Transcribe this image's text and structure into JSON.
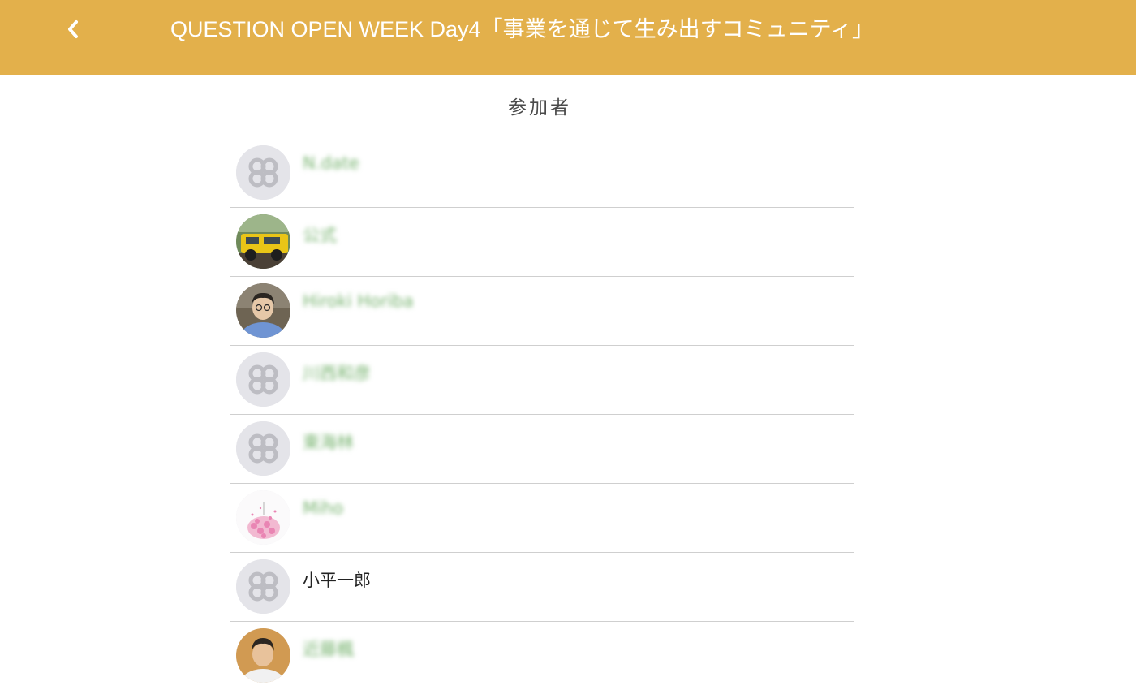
{
  "header": {
    "title": "QUESTION OPEN WEEK Day4「事業を通じて生み出すコミュニティ」",
    "back_icon": "chevron-left-icon",
    "background": "#e3b04b",
    "text_color": "#ffffff"
  },
  "participants": {
    "heading": "参加者",
    "items": [
      {
        "name": "N.date",
        "avatar": "default-avatar-icon",
        "blurred": true
      },
      {
        "name": "公式",
        "avatar": "photo-yellow-vehicle",
        "blurred": true
      },
      {
        "name": "Hiroki Horiba",
        "avatar": "photo-person-glasses",
        "blurred": true
      },
      {
        "name": "川西和彦",
        "avatar": "default-avatar-icon",
        "blurred": true
      },
      {
        "name": "東海林",
        "avatar": "default-avatar-icon",
        "blurred": true
      },
      {
        "name": "Miho",
        "avatar": "photo-pink-flowers",
        "blurred": true
      },
      {
        "name": "小平一郎",
        "avatar": "default-avatar-icon",
        "blurred": false
      },
      {
        "name": "近藤楓",
        "avatar": "photo-person-portrait",
        "blurred": true
      }
    ]
  },
  "colors": {
    "blurred_name": "#77b36f",
    "divider": "#cfcfcf",
    "default_avatar_bg": "#e4e4e9"
  }
}
